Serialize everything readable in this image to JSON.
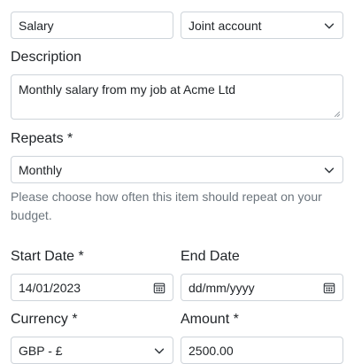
{
  "top": {
    "name_value": "Salary",
    "account_value": "Joint account"
  },
  "description": {
    "label": "Description",
    "value": "Monthly salary from my job at Acme Ltd"
  },
  "repeats": {
    "label": "Repeats *",
    "value": "Monthly",
    "help": "Please choose how often this item should repeat on your budget."
  },
  "start_date": {
    "label": "Start Date *",
    "value": "14/01/2023"
  },
  "end_date": {
    "label": "End Date",
    "placeholder": "dd/mm/yyyy"
  },
  "currency": {
    "label": "Currency *",
    "value": "GBP - £"
  },
  "amount": {
    "label": "Amount *",
    "value": "2500.00"
  },
  "icons": {
    "select": "chevron-down-icon",
    "date": "calendar-icon"
  }
}
